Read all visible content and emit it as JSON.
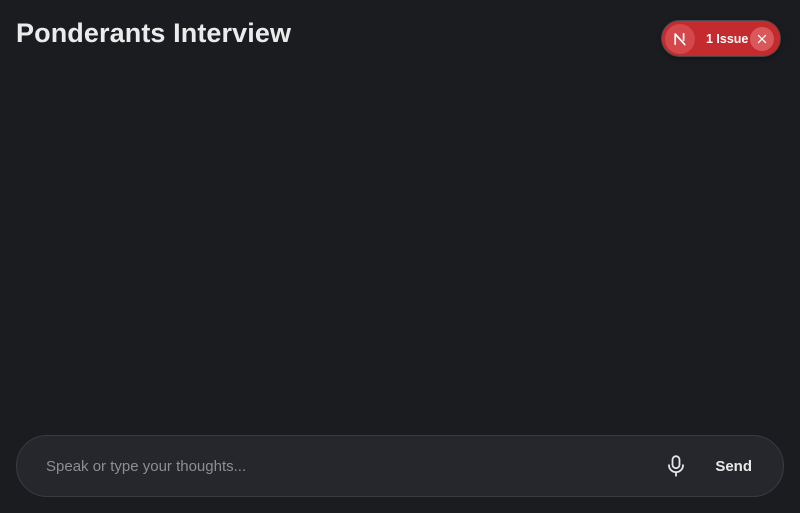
{
  "header": {
    "title": "Ponderants Interview"
  },
  "dev_overlay": {
    "logo_letter": "N",
    "issues_label": "1 Issue",
    "icons": {
      "logo": "nextjs-logo-icon",
      "close": "close-icon"
    }
  },
  "composer": {
    "placeholder": "Speak or type your thoughts...",
    "value": "",
    "send_label": "Send",
    "mic_icon": "microphone-icon"
  },
  "colors": {
    "background": "#1b1c20",
    "composer_background": "#26272c",
    "badge_red": "#c42b2f",
    "text": "#ebebeb",
    "placeholder": "#8d8e93"
  }
}
